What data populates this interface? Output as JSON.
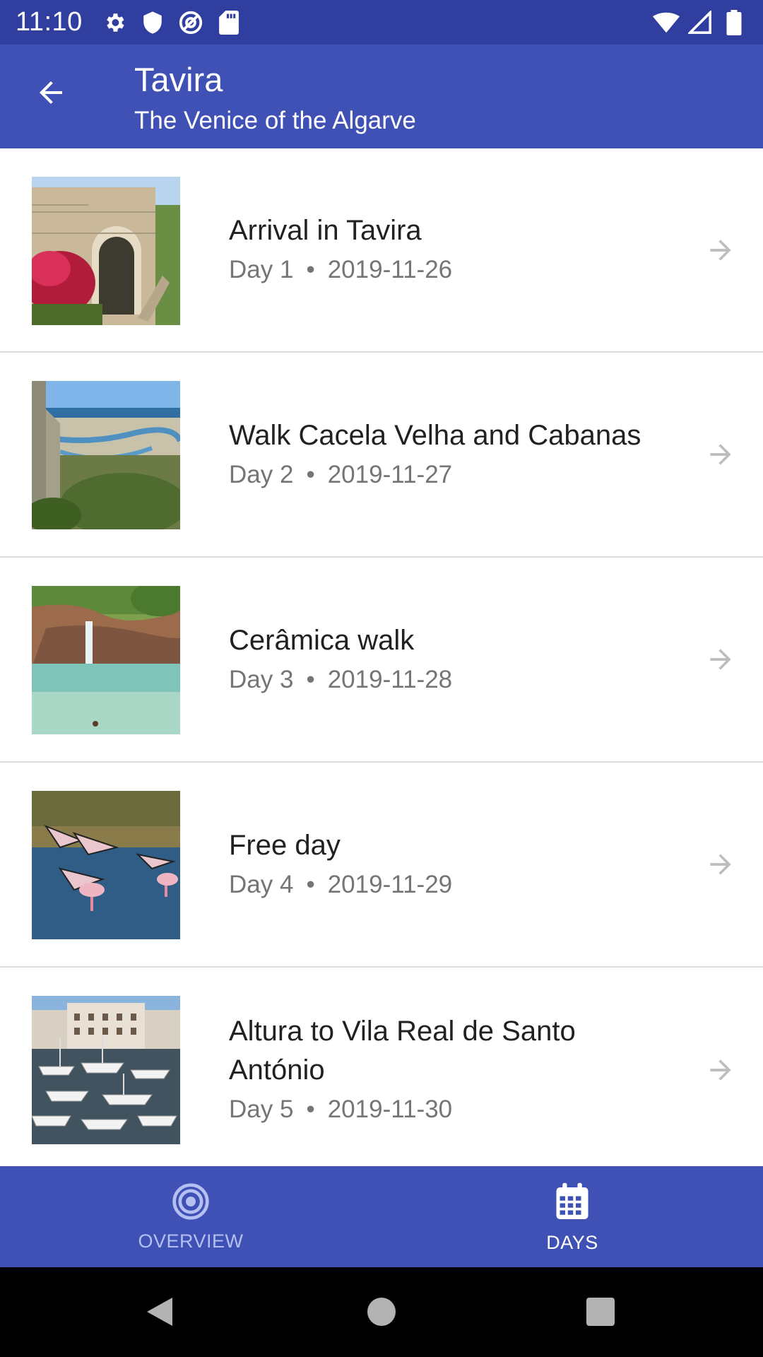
{
  "status_bar": {
    "time": "11:10",
    "icons_left": [
      "settings-icon",
      "shield-icon",
      "at-icon",
      "sd-card-icon"
    ],
    "icons_right": [
      "wifi-icon",
      "signal-icon",
      "battery-icon"
    ]
  },
  "app_bar": {
    "title": "Tavira",
    "subtitle": "The Venice of the Algarve",
    "back_icon": "arrow-left-icon"
  },
  "days": [
    {
      "title": "Arrival in Tavira",
      "day": "Day 1",
      "date": "2019-11-26",
      "thumb": "gate-photo"
    },
    {
      "title": "Walk Cacela Velha and Cabanas",
      "day": "Day 2",
      "date": "2019-11-27",
      "thumb": "coast-photo"
    },
    {
      "title": "Cerâmica walk",
      "day": "Day 3",
      "date": "2019-11-28",
      "thumb": "waterfall-photo"
    },
    {
      "title": "Free day",
      "day": "Day 4",
      "date": "2019-11-29",
      "thumb": "flamingo-photo"
    },
    {
      "title": "Altura to Vila Real de Santo António",
      "day": "Day 5",
      "date": "2019-11-30",
      "thumb": "harbour-photo"
    }
  ],
  "separator_dot": "•",
  "bottom_nav": [
    {
      "label": "OVERVIEW",
      "icon": "target-icon",
      "active": false
    },
    {
      "label": "DAYS",
      "icon": "calendar-icon",
      "active": true
    }
  ],
  "system_nav": [
    "back-triangle-icon",
    "home-circle-icon",
    "recents-square-icon"
  ],
  "colors": {
    "status_bar": "#303f9f",
    "primary": "#3f51b5",
    "nav_inactive": "#b4bff2",
    "title_text": "#212121",
    "secondary_text": "#757575",
    "divider": "#dddddd"
  }
}
